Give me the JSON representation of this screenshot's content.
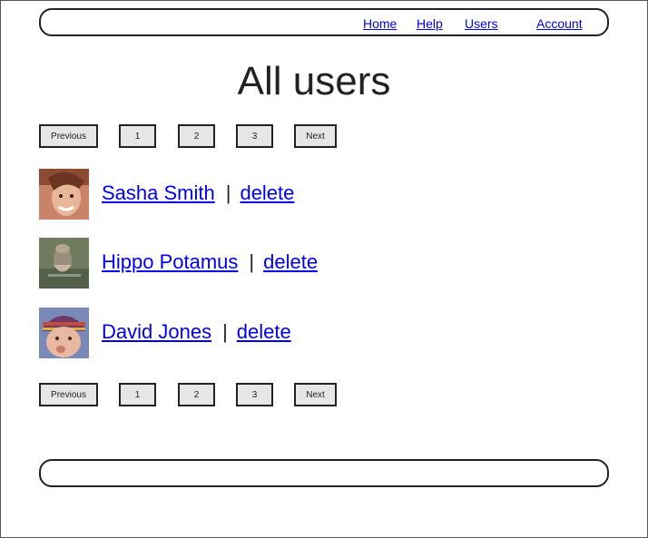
{
  "nav": {
    "home": "Home",
    "help": "Help",
    "users": "Users",
    "account": "Account"
  },
  "page": {
    "title": "All users"
  },
  "pagination": {
    "previous": "Previous",
    "pages": [
      "1",
      "2",
      "3"
    ],
    "next": "Next"
  },
  "users": [
    {
      "name": "Sasha Smith",
      "action": "delete",
      "separator": "|"
    },
    {
      "name": "Hippo Potamus",
      "action": "delete",
      "separator": "|"
    },
    {
      "name": "David Jones",
      "action": "delete",
      "separator": "|"
    }
  ],
  "colors": {
    "link": "#0000ee",
    "button_bg": "#e6e6e6",
    "border": "#222222"
  }
}
